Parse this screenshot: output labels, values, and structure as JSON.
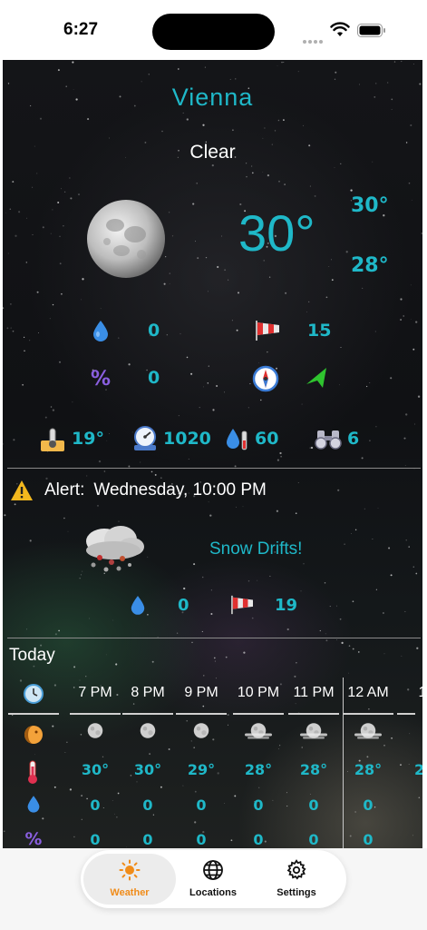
{
  "status": {
    "time": "6:27"
  },
  "current": {
    "city": "Vienna",
    "condition": "Clear",
    "temp": "30°",
    "high": "30°",
    "low": "28°",
    "precip": "0",
    "wind": "15",
    "humidity": "0",
    "dew_point": "19°",
    "pressure": "1020",
    "precip_pct": "60",
    "visibility": "6"
  },
  "alert": {
    "label": "Alert:",
    "time": "Wednesday,  10:00 PM",
    "event": "Snow Drifts!",
    "precip": "0",
    "wind": "19"
  },
  "today": {
    "title": "Today",
    "hours": [
      "7 PM",
      "8 PM",
      "9 PM",
      "10 PM",
      "11 PM",
      "12 AM",
      "1"
    ],
    "temps": [
      "30°",
      "30°",
      "29°",
      "28°",
      "28°",
      "28°",
      "2"
    ],
    "precip": [
      "0",
      "0",
      "0",
      "0",
      "0",
      "0"
    ],
    "precip_pct": [
      "0",
      "0",
      "0",
      "0",
      "0",
      "0"
    ]
  },
  "tabs": [
    {
      "label": "Weather",
      "icon": "sun-icon"
    },
    {
      "label": "Locations",
      "icon": "globe-icon"
    },
    {
      "label": "Settings",
      "icon": "gear-icon"
    }
  ],
  "colors": {
    "accent": "#1fb8c8",
    "tab_active": "#f08c1a"
  }
}
